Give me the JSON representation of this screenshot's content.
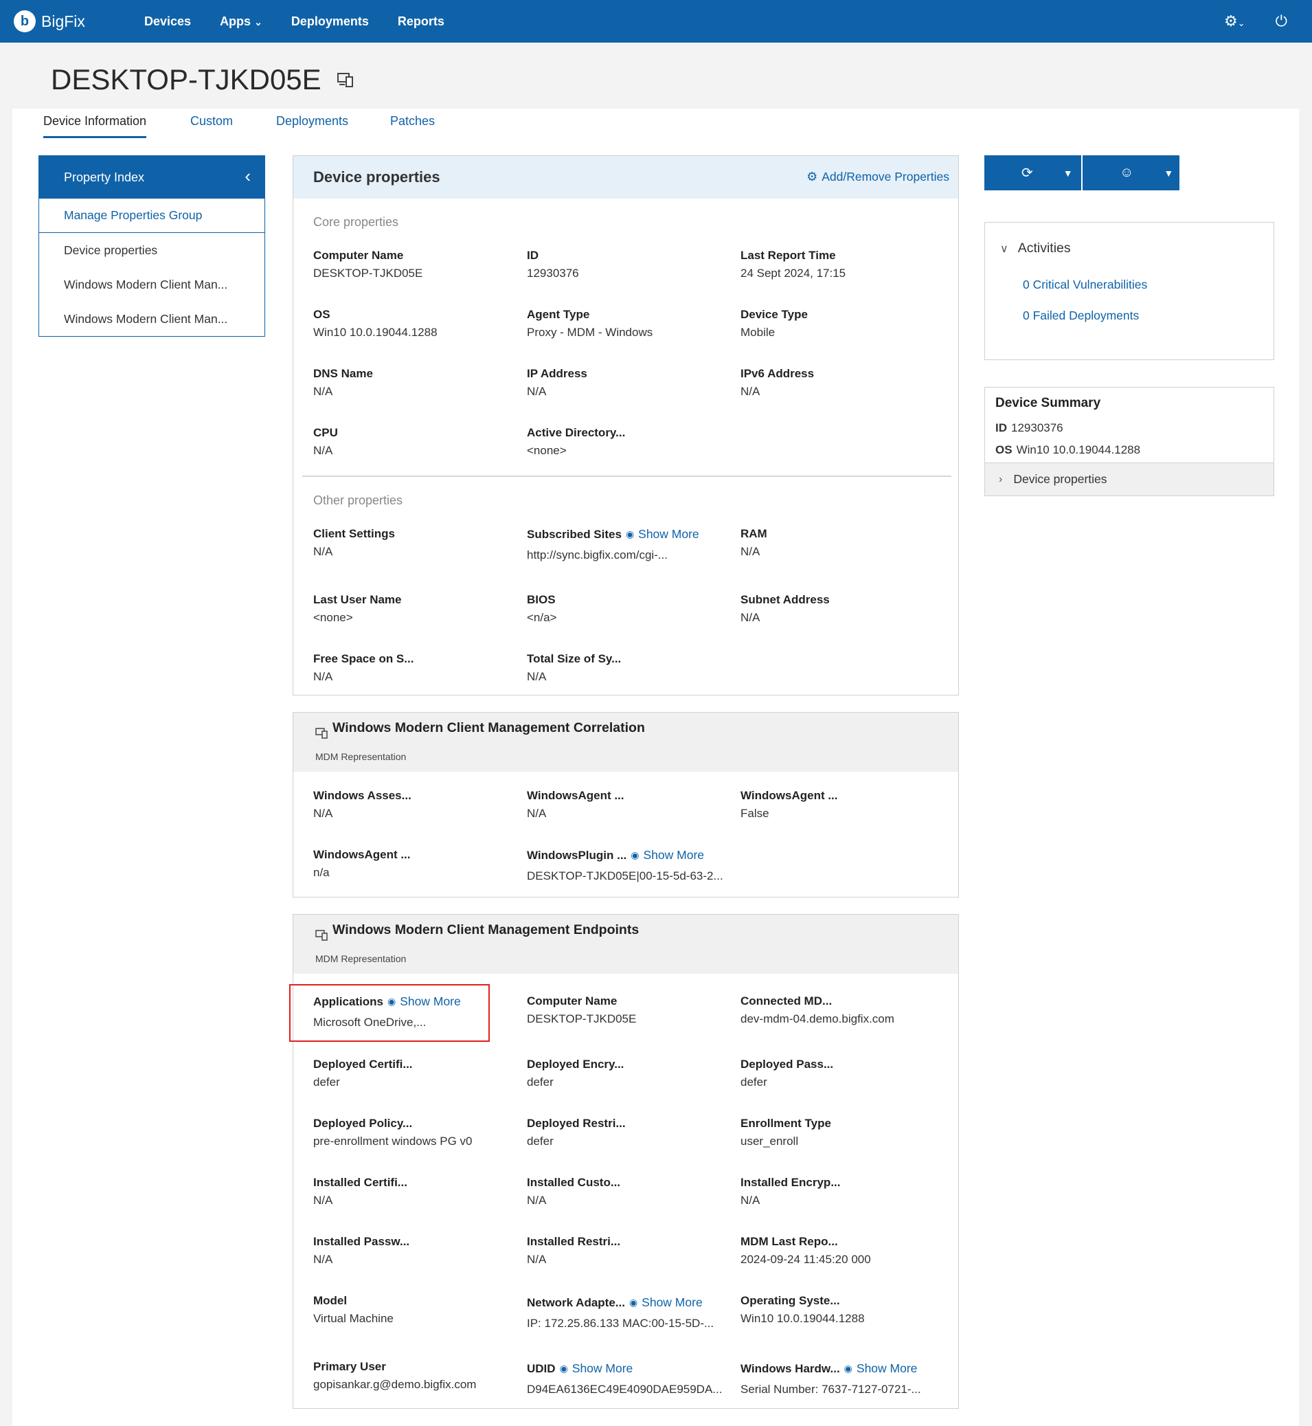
{
  "nav": {
    "brand": "BigFix",
    "brand_mark": "b",
    "items": [
      "Devices",
      "Apps",
      "Deployments",
      "Reports"
    ],
    "apps_caret": "⌄",
    "settings_icon": "gear-icon",
    "power_icon": "power-icon"
  },
  "page": {
    "title": "DESKTOP-TJKD05E"
  },
  "tabs": [
    "Device Information",
    "Custom",
    "Deployments",
    "Patches"
  ],
  "property_index": {
    "title": "Property Index",
    "collapse_glyph": "‹",
    "manage_link": "Manage Properties Group",
    "items": [
      "Device properties",
      "Windows Modern Client Man...",
      "Windows Modern Client Man..."
    ]
  },
  "device_properties": {
    "title": "Device properties",
    "add_remove": "Add/Remove Properties",
    "core_label": "Core properties",
    "other_label": "Other properties",
    "show_more": "Show More",
    "core": [
      {
        "k": "Computer Name",
        "v": "DESKTOP-TJKD05E"
      },
      {
        "k": "ID",
        "v": "12930376"
      },
      {
        "k": "Last Report Time",
        "v": "24 Sept 2024, 17:15"
      },
      {
        "k": "OS",
        "v": "Win10 10.0.19044.1288"
      },
      {
        "k": "Agent Type",
        "v": "Proxy - MDM - Windows"
      },
      {
        "k": "Device Type",
        "v": "Mobile"
      },
      {
        "k": "DNS Name",
        "v": "N/A"
      },
      {
        "k": "IP Address",
        "v": "N/A"
      },
      {
        "k": "IPv6 Address",
        "v": "N/A"
      },
      {
        "k": "CPU",
        "v": "N/A"
      },
      {
        "k": "Active Directory...",
        "v": "<none>"
      }
    ],
    "other": [
      {
        "k": "Client Settings",
        "v": "N/A"
      },
      {
        "k": "Subscribed Sites",
        "v": "http://sync.bigfix.com/cgi-..."
      },
      {
        "k": "RAM",
        "v": "N/A"
      },
      {
        "k": "Last User Name",
        "v": "<none>"
      },
      {
        "k": "BIOS",
        "v": "<n/a>"
      },
      {
        "k": "Subnet Address",
        "v": "N/A"
      },
      {
        "k": "Free Space on S...",
        "v": "N/A"
      },
      {
        "k": "Total Size of Sy...",
        "v": "N/A"
      }
    ]
  },
  "wmcm_correlation": {
    "title": "Windows Modern Client Management Correlation",
    "subtitle": "MDM Representation",
    "props": [
      {
        "k": "Windows Asses...",
        "v": "N/A"
      },
      {
        "k": "WindowsAgent ...",
        "v": "N/A"
      },
      {
        "k": "WindowsAgent ...",
        "v": "False"
      },
      {
        "k": "WindowsAgent ...",
        "v": "n/a"
      },
      {
        "k": "WindowsPlugin ...",
        "v": "DESKTOP-TJKD05E|00-15-5d-63-2..."
      }
    ]
  },
  "wmcm_endpoints": {
    "title": "Windows Modern Client Management Endpoints",
    "subtitle": "MDM Representation",
    "props": [
      {
        "k": "Applications",
        "v": "Microsoft OneDrive,..."
      },
      {
        "k": "Computer Name",
        "v": "DESKTOP-TJKD05E"
      },
      {
        "k": "Connected MD...",
        "v": "dev-mdm-04.demo.bigfix.com"
      },
      {
        "k": "Deployed Certifi...",
        "v": "defer"
      },
      {
        "k": "Deployed Encry...",
        "v": "defer"
      },
      {
        "k": "Deployed Pass...",
        "v": "defer"
      },
      {
        "k": "Deployed Policy...",
        "v": "pre-enrollment windows PG v0"
      },
      {
        "k": "Deployed Restri...",
        "v": "defer"
      },
      {
        "k": "Enrollment Type",
        "v": "user_enroll"
      },
      {
        "k": "Installed Certifi...",
        "v": "N/A"
      },
      {
        "k": "Installed Custo...",
        "v": "N/A"
      },
      {
        "k": "Installed Encryp...",
        "v": "N/A"
      },
      {
        "k": "Installed Passw...",
        "v": "N/A"
      },
      {
        "k": "Installed Restri...",
        "v": "N/A"
      },
      {
        "k": "MDM Last Repo...",
        "v": "2024-09-24 11:45:20 000"
      },
      {
        "k": "Model",
        "v": "Virtual Machine"
      },
      {
        "k": "Network Adapte...",
        "v": "IP: 172.25.86.133 MAC:00-15-5D-..."
      },
      {
        "k": "Operating Syste...",
        "v": "Win10 10.0.19044.1288"
      },
      {
        "k": "Primary User",
        "v": "gopisankar.g@demo.bigfix.com"
      },
      {
        "k": "UDID",
        "v": "D94EA6136EC49E4090DAE959DA..."
      },
      {
        "k": "Windows Hardw...",
        "v": "Serial Number: 7637-7127-0721-..."
      }
    ]
  },
  "actions": {
    "button1_icon": "refresh-clock-icon",
    "button2_icon": "user-add-icon"
  },
  "activities": {
    "title": "Activities",
    "links": [
      "0 Critical Vulnerabilities",
      "0 Failed Deployments"
    ]
  },
  "device_summary": {
    "title": "Device Summary",
    "id_label": "ID",
    "id_value": "12930376",
    "os_label": "OS",
    "os_value": "Win10 10.0.19044.1288",
    "footer": "Device properties"
  },
  "colors": {
    "brand_blue": "#0f62a7",
    "highlight_red": "#e02020"
  }
}
